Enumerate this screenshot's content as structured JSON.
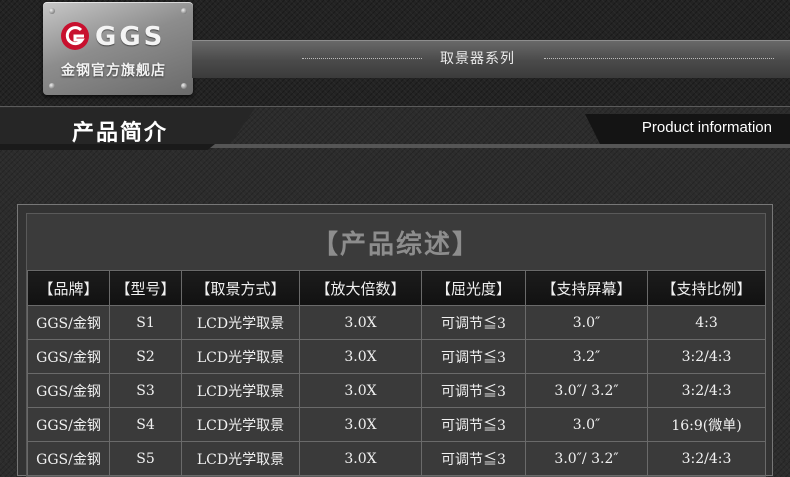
{
  "logo": {
    "brand": "GGS",
    "subtitle": "金钢官方旗舰店",
    "accent_color": "#c8102e"
  },
  "series_label": "取景器系列",
  "section": {
    "title": "产品简介",
    "title_en": "Product information"
  },
  "panel": {
    "title": "【产品综述】"
  },
  "table": {
    "headers": [
      "【品牌】",
      "【型号】",
      "【取景方式】",
      "【放大倍数】",
      "【屈光度】",
      "【支持屏幕】",
      "【支持比例】"
    ],
    "rows": [
      [
        "GGS/金钢",
        "S1",
        "LCD光学取景",
        "3.0X",
        "可调节≦3",
        "3.0″",
        "4:3"
      ],
      [
        "GGS/金钢",
        "S2",
        "LCD光学取景",
        "3.0X",
        "可调节≦3",
        "3.2″",
        "3:2/4:3"
      ],
      [
        "GGS/金钢",
        "S3",
        "LCD光学取景",
        "3.0X",
        "可调节≦3",
        "3.0″/ 3.2″",
        "3:2/4:3"
      ],
      [
        "GGS/金钢",
        "S4",
        "LCD光学取景",
        "3.0X",
        "可调节≦3",
        "3.0″",
        "16:9(微单)"
      ],
      [
        "GGS/金钢",
        "S5",
        "LCD光学取景",
        "3.0X",
        "可调节≦3",
        "3.0″/ 3.2″",
        "3:2/4:3"
      ]
    ]
  }
}
